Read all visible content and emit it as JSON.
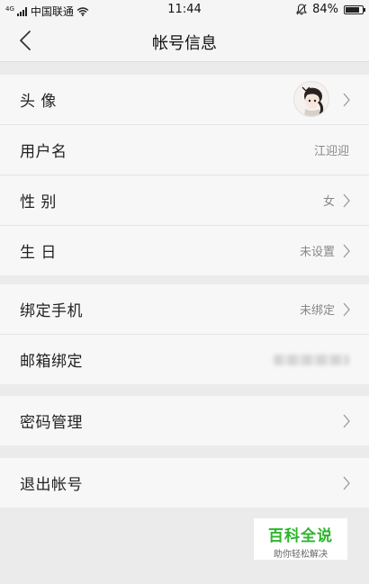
{
  "status_bar": {
    "network_type": "4G",
    "carrier": "中国联通",
    "time": "11:44",
    "battery_percent": "84%",
    "battery_level": 0.84
  },
  "nav": {
    "title": "帐号信息"
  },
  "groups": [
    {
      "rows": [
        {
          "label": "头 像",
          "value": ""
        },
        {
          "label": "用户名",
          "value": "江迎迎"
        },
        {
          "label": "性 别",
          "value": "女"
        },
        {
          "label": "生 日",
          "value": "未设置"
        }
      ]
    },
    {
      "rows": [
        {
          "label": "绑定手机",
          "value": "未绑定"
        },
        {
          "label": "邮箱绑定",
          "value": ""
        }
      ]
    },
    {
      "rows": [
        {
          "label": "密码管理",
          "value": ""
        }
      ]
    },
    {
      "rows": [
        {
          "label": "退出帐号",
          "value": ""
        }
      ]
    }
  ],
  "watermark": {
    "title": "百科全说",
    "subtitle": "助你轻松解决"
  },
  "icons": {
    "back": "chevron-left-icon",
    "row_arrow": "chevron-right-icon",
    "wifi": "wifi-icon",
    "signal": "signal-icon",
    "mute": "bell-off-icon",
    "battery": "battery-icon"
  },
  "colors": {
    "background": "#ebebeb",
    "row_background": "#f7f7f7",
    "watermark_green": "#2db52d"
  }
}
